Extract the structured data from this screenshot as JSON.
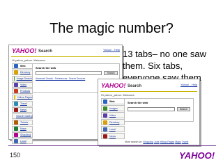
{
  "slide": {
    "title": "The magic number?",
    "body": "13 tabs– no one saw them. Six tabs, everyone saw them",
    "page_number": "150",
    "footer_logo": "YAHOO!"
  },
  "screenshot_back": {
    "logo": "YAHOO!",
    "header": "Search",
    "top_links": "Yahoo! - Help",
    "welcome": "Hi yahoo_yahoo. Welcome.",
    "search_label": "Search the web",
    "search_button": "Search",
    "panel_links": "Advanced Search · Preferences · Search Services",
    "tabs": [
      {
        "label": "Web",
        "icon": "web-icon",
        "color": "#2a63c8"
      },
      {
        "label": "Directory",
        "icon": "directory-icon",
        "color": "#d9a200"
      },
      {
        "label": "Image Search",
        "icon": "image-icon",
        "color": "#3b8c2b"
      },
      {
        "label": "Video",
        "icon": "video-icon",
        "color": "#5a3fa8"
      },
      {
        "label": "Products",
        "icon": "products-icon",
        "color": "#c83b1e"
      },
      {
        "label": "Yellow Pages",
        "icon": "yellowpages-icon",
        "color": "#e3c100"
      },
      {
        "label": "Travel",
        "icon": "travel-icon",
        "color": "#2e8bb4"
      },
      {
        "label": "News",
        "icon": "news-icon",
        "color": "#9a1a1a"
      },
      {
        "label": "Search Gallery",
        "icon": "gallery-icon",
        "color": "#777777"
      },
      {
        "label": "Tickets",
        "icon": "tickets-icon",
        "color": "#b45a00"
      },
      {
        "label": "Maps",
        "icon": "maps-icon",
        "color": "#1f7a3a"
      },
      {
        "label": "Shopping",
        "icon": "shopping-icon",
        "color": "#b3008f"
      },
      {
        "label": "Local",
        "icon": "local-icon",
        "color": "#4066b3"
      }
    ]
  },
  "screenshot_front": {
    "logo": "YAHOO!",
    "header": "Search",
    "top_links": "Yahoo! - Help",
    "welcome": "Hi yahoo_yahoo. Welcome.",
    "search_label": "Search the web",
    "search_button": "Search",
    "tabs": [
      {
        "label": "Web",
        "icon": "web-icon",
        "color": "#2a63c8"
      },
      {
        "label": "Images",
        "icon": "image-icon",
        "color": "#3b8c2b"
      },
      {
        "label": "Video",
        "icon": "video-icon",
        "color": "#5a3fa8"
      },
      {
        "label": "Directory",
        "icon": "directory-icon",
        "color": "#d9a200"
      },
      {
        "label": "Local",
        "icon": "local-icon",
        "color": "#4066b3"
      },
      {
        "label": "News",
        "icon": "news-icon",
        "color": "#9a1a1a"
      }
    ],
    "bottom_links_prefix": "More search on:",
    "bottom_links": [
      "Shopping",
      "Jobs",
      "Yellow Pages",
      "Maps",
      "Travel"
    ]
  },
  "colors": {
    "yahoo_purple": "#7b0099",
    "accent_line": "#6a2b8c"
  }
}
